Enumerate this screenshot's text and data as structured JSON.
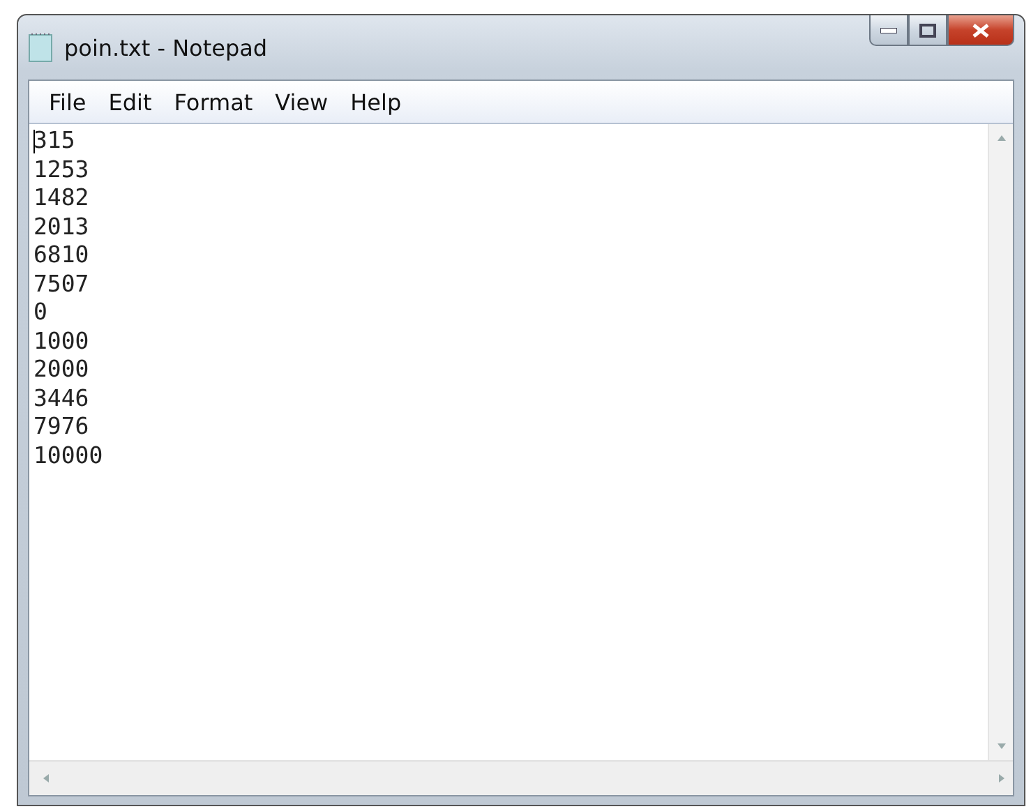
{
  "window": {
    "title": "poin.txt - Notepad"
  },
  "menu": [
    "File",
    "Edit",
    "Format",
    "View",
    "Help"
  ],
  "document": {
    "lines": [
      "315",
      "1253",
      "1482",
      "2013",
      "6810",
      "7507",
      "0",
      "1000",
      "2000",
      "3446",
      "7976",
      "10000"
    ]
  }
}
